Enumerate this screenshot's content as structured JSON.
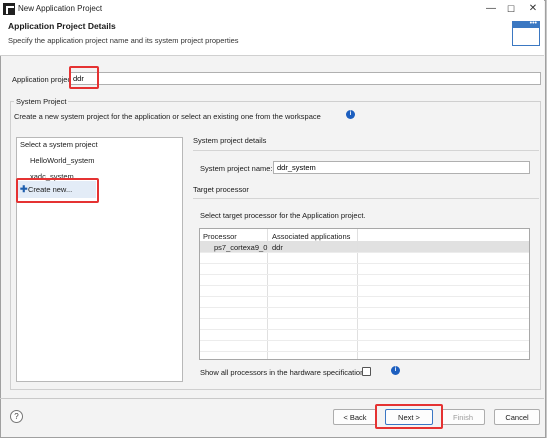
{
  "window": {
    "title": "New Application Project",
    "controls": {
      "minimize": "—",
      "maximize": "☐",
      "close": "✕"
    }
  },
  "header": {
    "title": "Application Project Details",
    "description": "Specify the application project name and its system project properties"
  },
  "project_name": {
    "label": "Application project name:",
    "value": "ddr"
  },
  "system_project": {
    "group_label": "System Project",
    "description": "Create a new system project for the application or select an existing one from the workspace",
    "list": {
      "header": "Select a system project",
      "items": [
        "HelloWorld_system",
        "xadc_system"
      ],
      "create_new": "Create new..."
    },
    "details": {
      "header": "System project details",
      "name_label": "System project name:",
      "name_value": "ddr_system"
    },
    "target": {
      "header": "Target processor",
      "description": "Select target processor for the Application project.",
      "columns": [
        "Processor",
        "Associated applications"
      ],
      "rows": [
        {
          "processor": "ps7_cortexa9_0",
          "apps": "ddr"
        }
      ],
      "show_all_label": "Show all processors in the hardware specification"
    }
  },
  "footer": {
    "help": "?",
    "back": "< Back",
    "next": "Next >",
    "finish": "Finish",
    "cancel": "Cancel"
  },
  "colors": {
    "highlight": "#e53232",
    "accent": "#3b78c2",
    "info_icon": "#1d5fbf"
  }
}
